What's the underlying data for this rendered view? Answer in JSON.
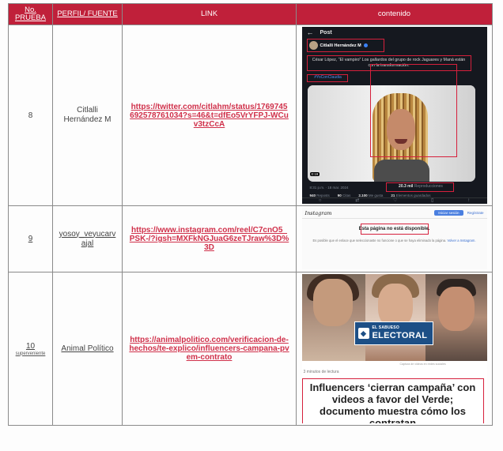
{
  "headers": {
    "num": "No. PRUEBA",
    "profile": "PERFIL/ FUENTE",
    "link": "LINK",
    "content": "contenido"
  },
  "rows": [
    {
      "num": "8",
      "profile": "Citlalli Hernández M",
      "link": "https://twitter.com/citlahm/status/1769745692578761034?s=46&t=dfEo5VrYFPJ-WCuv3tzCcA",
      "twitter": {
        "title": "Post",
        "user": "Citlalli Hernández M",
        "text": "César López, “El vampiro” Los gallardos del grupo de rock Jaguares y Maná están con la transformación.",
        "tag": "#YoConClaudia",
        "duration": "0:19",
        "meta": "8:31 p.m. · 18 mar. 2024",
        "views": "20.3 mil",
        "views_label": "Reproducciones",
        "stats": [
          {
            "n": "940",
            "label": "Reposts"
          },
          {
            "n": "90",
            "label": "Citas"
          },
          {
            "n": "2.100",
            "label": "Me gusta"
          },
          {
            "n": "21",
            "label": "Elementos guardados"
          }
        ]
      }
    },
    {
      "num": "9",
      "profile": "yosoy_veyucarvajal",
      "link": "https://www.instagram.com/reel/C7cnO5_PSK-/?igsh=MXFkNGJuaG6zeTJraw%3D%3D",
      "instagram": {
        "logo": "Instagram",
        "login": "Iniciar sesión",
        "signup": "Regístrate",
        "message": "Esta página no está disponible.",
        "sub": "Es posible que el enlace que seleccionaste no funcione o que se haya eliminado la página.",
        "sub_link": "Volver a Instagram."
      }
    },
    {
      "num": "10",
      "num_note": "superveniente",
      "profile": "Animal Político",
      "link": "https://animalpolitico.com/verificacion-de-hechos/te-explico/influencers-campana-pvem-contrato",
      "article": {
        "badge_small": "EL SABUESO",
        "badge_large": "ELECTORAL",
        "caption": "Captura de videos en redes sociales",
        "read_time": "3 minutos de lectura",
        "headline": "Influencers ‘cierran campaña’ con videos a favor del Verde; documento muestra cómo los contratan"
      }
    }
  ]
}
